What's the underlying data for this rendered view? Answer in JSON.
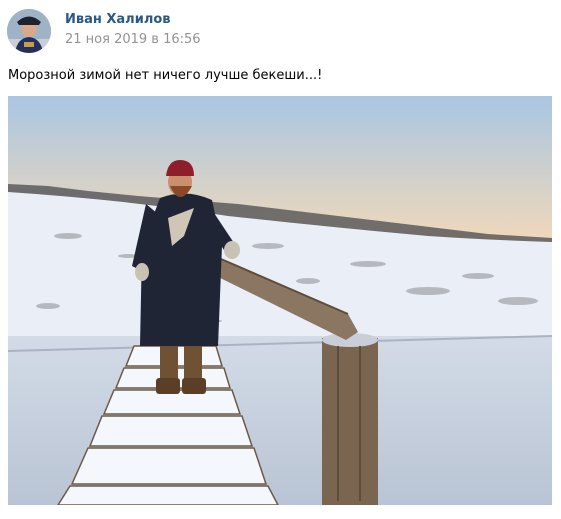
{
  "post": {
    "author_name": "Иван Халилов",
    "date": "21 ноя 2019 в 16:56",
    "text": "Морозной зимой нет ничего лучше бекеши...!"
  },
  "photo": {
    "subject": "man-in-winter-coat-on-snowy-footbridge",
    "colors": {
      "sky_top": "#a9c6e3",
      "sky_bottom": "#f2d9b8",
      "snow": "#e9eef7",
      "ice": "#c9d2df",
      "coat": "#1f2535",
      "hat": "#8e1f2a",
      "wood": "#7a6650"
    }
  },
  "avatar": {
    "icon": "user-avatar-photo"
  }
}
